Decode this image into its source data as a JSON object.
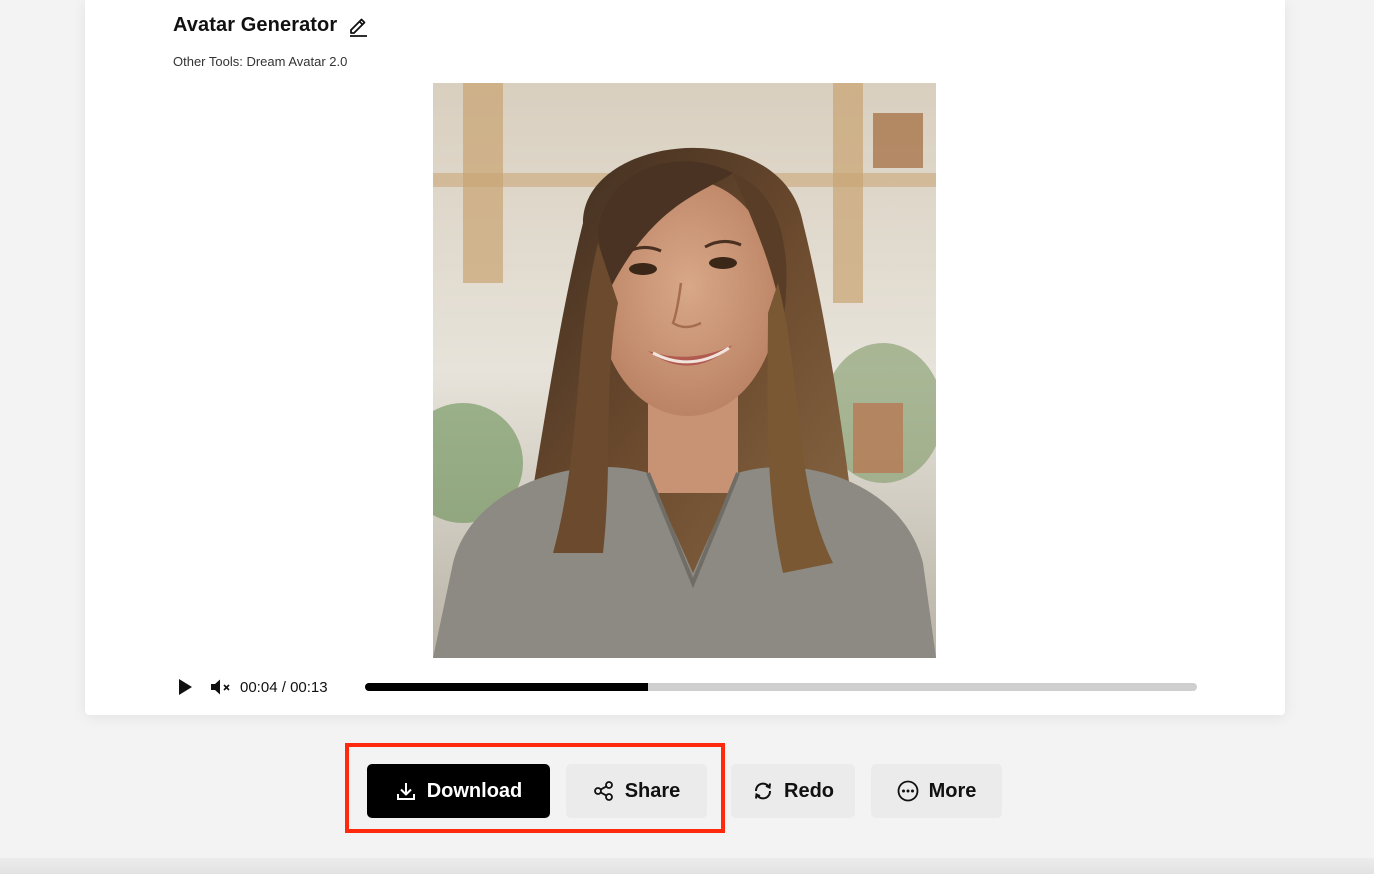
{
  "header": {
    "title": "Avatar Generator",
    "subtitle": "Other Tools: Dream Avatar 2.0"
  },
  "player": {
    "current_time": "00:04",
    "duration": "00:13",
    "time_separator": "/",
    "progress_fraction": 0.34,
    "muted": true
  },
  "actions": {
    "download_label": "Download",
    "share_label": "Share",
    "redo_label": "Redo",
    "more_label": "More"
  },
  "icons": {
    "edit": "pencil-icon",
    "play": "play-icon",
    "mute": "volume-muted-icon",
    "download": "download-icon",
    "share": "share-icon",
    "redo": "redo-icon",
    "more": "more-icon"
  },
  "colors": {
    "primary_button": "#000000",
    "secondary_button": "#ebebeb",
    "highlight": "#ff2a0e",
    "progress_fill": "#000000",
    "progress_track": "#cfcfcf"
  }
}
